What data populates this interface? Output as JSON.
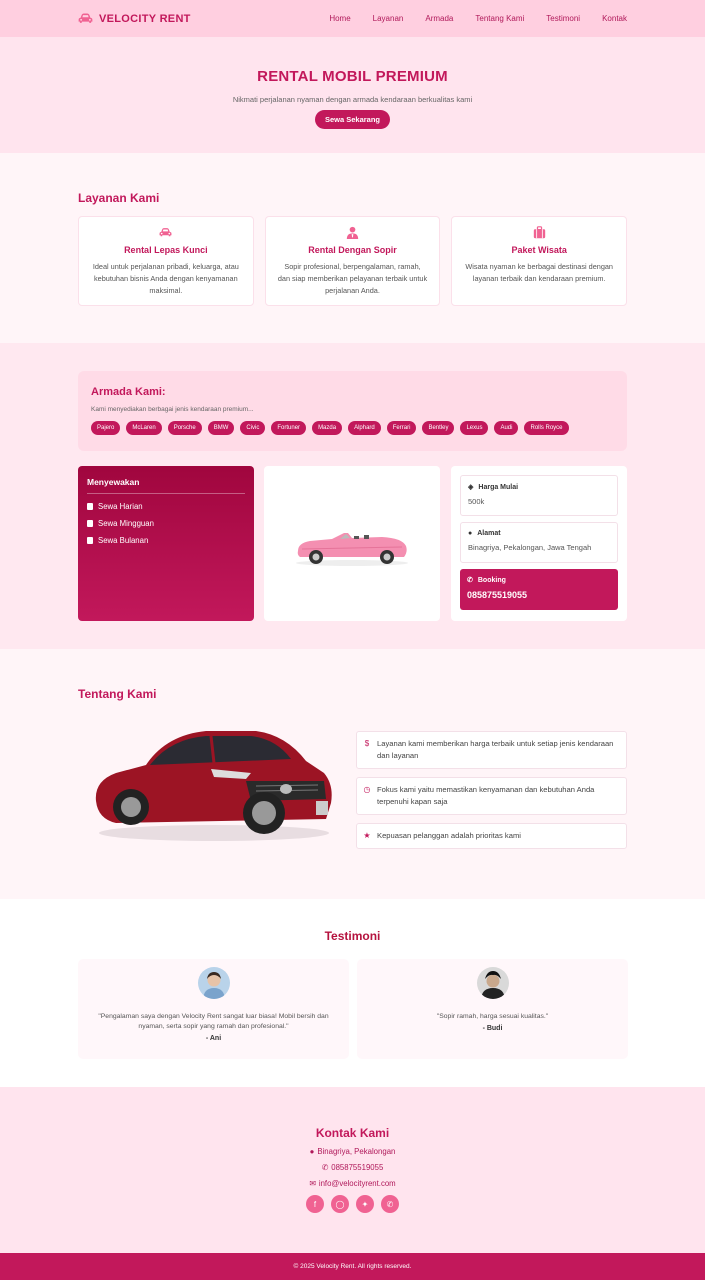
{
  "brand": {
    "name": "VELOCITY RENT",
    "icon": "car-icon"
  },
  "nav": [
    "Home",
    "Layanan",
    "Armada",
    "Tentang Kami",
    "Testimoni",
    "Kontak"
  ],
  "hero": {
    "title": "RENTAL MOBIL PREMIUM",
    "subtitle": "Nikmati perjalanan nyaman dengan armada kendaraan berkualitas kami",
    "cta": "Sewa Sekarang"
  },
  "services": {
    "title": "Layanan Kami",
    "items": [
      {
        "icon": "car-icon",
        "title": "Rental Lepas Kunci",
        "desc": "Ideal untuk perjalanan pribadi, keluarga, atau kebutuhan bisnis Anda dengan kenyamanan maksimal."
      },
      {
        "icon": "driver-icon",
        "title": "Rental Dengan Sopir",
        "desc": "Sopir profesional, berpengalaman, ramah, dan siap memberikan pelayanan terbaik untuk perjalanan Anda."
      },
      {
        "icon": "suitcase-icon",
        "title": "Paket Wisata",
        "desc": "Wisata nyaman ke berbagai destinasi dengan layanan terbaik dan kendaraan premium."
      }
    ]
  },
  "armada": {
    "title": "Armada Kami:",
    "desc": "Kami menyediakan berbagai jenis kendaraan premium...",
    "brands": [
      "Pajero",
      "McLaren",
      "Porsche",
      "BMW",
      "Civic",
      "Fortuner",
      "Mazda",
      "Alphard",
      "Ferrari",
      "Bentley",
      "Lexus",
      "Audi",
      "Rolls Royce"
    ]
  },
  "rent": {
    "title": "Menyewakan",
    "options": [
      "Sewa Harian",
      "Sewa Mingguan",
      "Sewa Bulanan"
    ]
  },
  "info": {
    "price_label": "Harga Mulai",
    "price_value": "500k",
    "address_label": "Alamat",
    "address_value": "Binagriya, Pekalongan, Jawa Tengah",
    "booking_label": "Booking",
    "booking_value": "085875519055"
  },
  "about": {
    "title": "Tentang Kami",
    "points": [
      {
        "icon": "dollar-icon",
        "text": "Layanan kami memberikan harga terbaik untuk setiap jenis kendaraan dan layanan"
      },
      {
        "icon": "clock-icon",
        "text": "Fokus kami yaitu memastikan kenyamanan dan kebutuhan Anda terpenuhi kapan saja"
      },
      {
        "icon": "star-icon",
        "text": "Kepuasan pelanggan adalah prioritas kami"
      }
    ]
  },
  "testimonials": {
    "title": "Testimoni",
    "items": [
      {
        "quote": "\"Pengalaman saya dengan Velocity Rent sangat luar biasa! Mobil bersih dan nyaman, serta sopir yang ramah dan profesional.\"",
        "name": "- Ani"
      },
      {
        "quote": "\"Sopir ramah, harga sesuai kualitas.\"",
        "name": "- Budi"
      }
    ]
  },
  "contact": {
    "title": "Kontak Kami",
    "address": "Binagriya, Pekalongan",
    "phone": "085875519055",
    "email": "info@velocityrent.com",
    "socials": [
      "facebook-icon",
      "instagram-icon",
      "twitter-icon",
      "whatsapp-icon"
    ]
  },
  "footer": "© 2025 Velocity Rent. All rights reserved.",
  "colors": {
    "primary": "#c2185b",
    "pink_light": "#ffe4ee",
    "accent": "#f06292"
  }
}
